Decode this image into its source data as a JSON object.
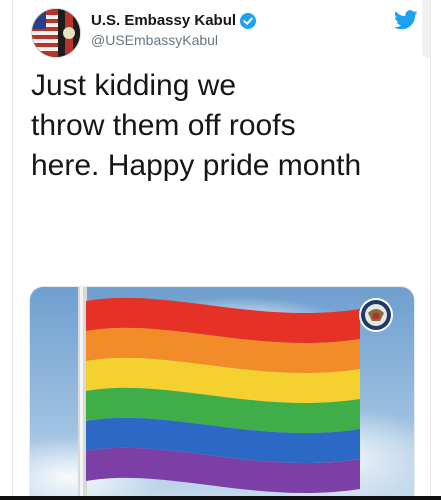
{
  "tweet": {
    "display_name": "U.S. Embassy Kabul",
    "handle": "@USEmbassyKabul",
    "text_lines": [
      "Just kidding we",
      "throw them off roofs",
      "here. Happy pride month"
    ],
    "avatar_icon": "embassy-flag-avatar",
    "verified_icon": "verified-badge-icon",
    "platform_icon": "twitter-bird-icon"
  },
  "media": {
    "subject": "rainbow-pride-flag",
    "seal_icon": "us-state-department-seal-icon",
    "flag_colors": [
      "#e53126",
      "#f28c28",
      "#f5d130",
      "#3fae49",
      "#2c69c7",
      "#7b3fa6"
    ]
  },
  "colors": {
    "brand_blue": "#1da1f2",
    "text": "#14171a",
    "muted": "#657786"
  }
}
